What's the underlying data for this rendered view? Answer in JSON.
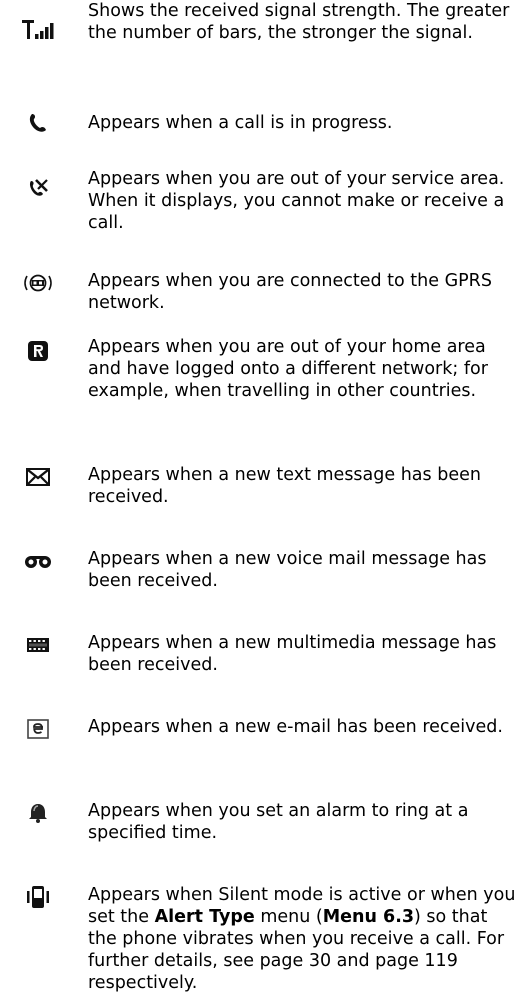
{
  "entries": [
    {
      "icon": "signal-strength-icon",
      "text": "Shows the received signal strength. The greater the number of bars, the stronger the signal."
    },
    {
      "icon": "call-in-progress-icon",
      "text": "Appears when a call is in progress."
    },
    {
      "icon": "no-service-icon",
      "text": "Appears when you are out of your service area. When it displays, you cannot make or receive a call."
    },
    {
      "icon": "gprs-icon",
      "text": "Appears when you are connected to the GPRS network."
    },
    {
      "icon": "roaming-icon",
      "text": "Appears when you are out of your home area and have logged onto a different network; for example, when travelling in other countries."
    },
    {
      "icon": "text-message-icon",
      "text": "Appears when a new text message has been received."
    },
    {
      "icon": "voice-mail-icon",
      "text": "Appears when a new voice mail message has been received."
    },
    {
      "icon": "multimedia-message-icon",
      "text": "Appears when a new multimedia message has been received."
    },
    {
      "icon": "email-icon",
      "text": "Appears when a new e-mail has been received."
    },
    {
      "icon": "alarm-icon",
      "text": "Appears when you set an alarm to ring at a specified time."
    },
    {
      "icon": "silent-mode-icon",
      "text_parts": {
        "p1": "Appears when Silent mode is active or when you set the ",
        "b1": "Alert Type",
        "p2": " menu (",
        "b2": "Menu 6.3",
        "p3": ") so that the phone vibrates when you receive a call. For further details, see page 30 and page 119 respectively."
      }
    }
  ]
}
